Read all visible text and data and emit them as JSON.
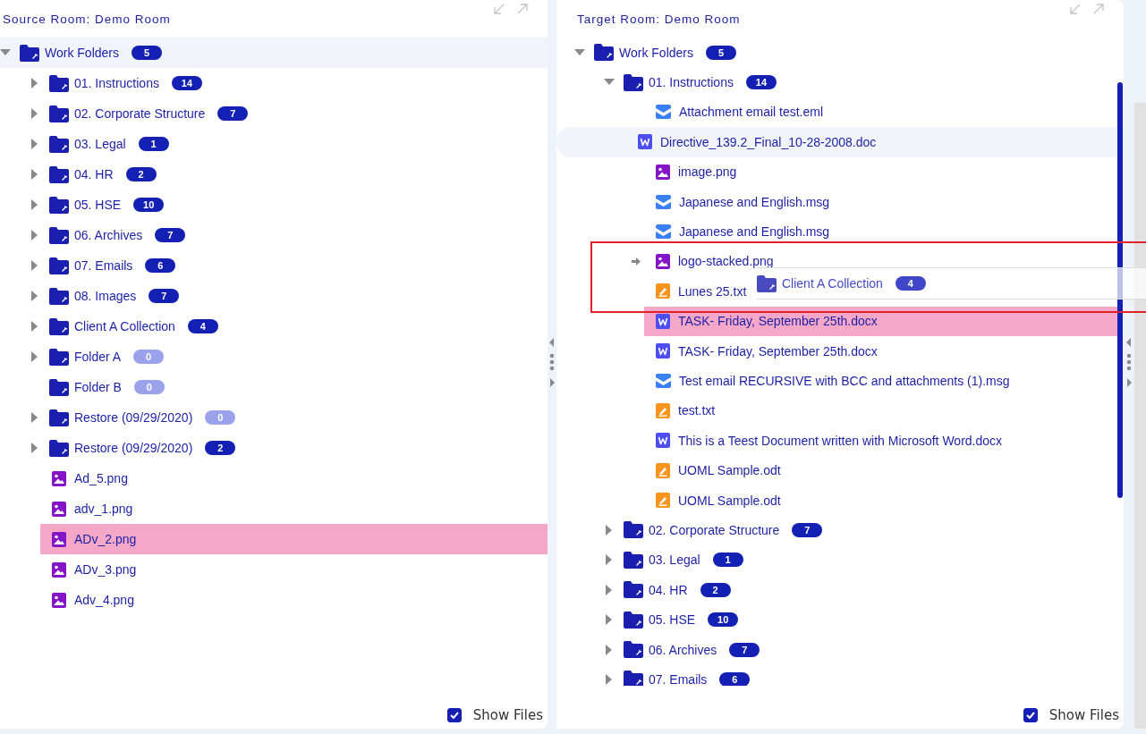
{
  "panels": [
    {
      "title": "Source Room: Demo Room",
      "show_files": {
        "label": "Show Files",
        "checked": true
      },
      "tree": [
        {
          "kind": "folder",
          "label": "Work Folders",
          "count": "5",
          "dimmed": false,
          "expanded": true,
          "selected": false,
          "hovered": true,
          "children": [
            {
              "kind": "folder",
              "label": "01. Instructions",
              "count": "14",
              "dimmed": false,
              "expanded": false,
              "selected": false
            },
            {
              "kind": "folder",
              "label": "02. Corporate Structure",
              "count": "7",
              "dimmed": false,
              "expanded": false,
              "selected": false
            },
            {
              "kind": "folder",
              "label": "03. Legal",
              "count": "1",
              "dimmed": false,
              "expanded": false,
              "selected": false
            },
            {
              "kind": "folder",
              "label": "04. HR",
              "count": "2",
              "dimmed": false,
              "expanded": false,
              "selected": false
            },
            {
              "kind": "folder",
              "label": "05. HSE",
              "count": "10",
              "dimmed": false,
              "expanded": false,
              "selected": false
            },
            {
              "kind": "folder",
              "label": "06. Archives",
              "count": "7",
              "dimmed": false,
              "expanded": false,
              "selected": false
            },
            {
              "kind": "folder",
              "label": "07. Emails",
              "count": "6",
              "dimmed": false,
              "expanded": false,
              "selected": false
            },
            {
              "kind": "folder",
              "label": "08. Images",
              "count": "7",
              "dimmed": false,
              "expanded": false,
              "selected": false
            },
            {
              "kind": "folder",
              "label": "Client A Collection",
              "count": "4",
              "dimmed": false,
              "expanded": false,
              "selected": false
            },
            {
              "kind": "folder",
              "label": "Folder A",
              "count": "0",
              "dimmed": true,
              "expanded": false,
              "selected": false
            },
            {
              "kind": "folder",
              "label": "Folder B",
              "count": "0",
              "dimmed": true,
              "selected": false
            },
            {
              "kind": "folder",
              "label": "Restore (09/29/2020)",
              "count": "0",
              "dimmed": true,
              "expanded": false,
              "selected": false
            },
            {
              "kind": "folder",
              "label": "Restore (09/29/2020)",
              "count": "2",
              "dimmed": false,
              "expanded": false,
              "selected": false
            },
            {
              "kind": "image",
              "label": "Ad_5.png",
              "selected": false
            },
            {
              "kind": "image",
              "label": "adv_1.png",
              "selected": false
            },
            {
              "kind": "image",
              "label": "ADv_2.png",
              "selected": true
            },
            {
              "kind": "image",
              "label": "ADv_3.png",
              "selected": false
            },
            {
              "kind": "image",
              "label": "Adv_4.png",
              "selected": false
            }
          ]
        }
      ]
    },
    {
      "title": "Target Room: Demo Room",
      "show_files": {
        "label": "Show Files",
        "checked": true
      },
      "drag_preview": {
        "label": "Client A Collection",
        "count": "4"
      },
      "tree": [
        {
          "kind": "folder",
          "label": "Work Folders",
          "count": "5",
          "dimmed": false,
          "expanded": true,
          "selected": false,
          "children": [
            {
              "kind": "folder",
              "label": "01. Instructions",
              "count": "14",
              "dimmed": false,
              "expanded": true,
              "selected": false,
              "children": [
                {
                  "kind": "email",
                  "label": "Attachment email test.eml",
                  "selected": false
                },
                {
                  "kind": "word",
                  "label": "Directive_139.2_Final_10-28-2008.doc",
                  "selected": false,
                  "hovered": true
                },
                {
                  "kind": "image",
                  "label": "image.png",
                  "selected": false
                },
                {
                  "kind": "email",
                  "label": "Japanese and English.msg",
                  "selected": false
                },
                {
                  "kind": "email",
                  "label": "Japanese and English.msg",
                  "selected": false
                },
                {
                  "kind": "image",
                  "label": "logo-stacked.png",
                  "selected": false,
                  "drop_target": true
                },
                {
                  "kind": "text",
                  "label": "Lunes 25.txt",
                  "selected": false
                },
                {
                  "kind": "word",
                  "label": "TASK- Friday, September 25th.docx",
                  "selected": true
                },
                {
                  "kind": "word",
                  "label": "TASK- Friday, September 25th.docx",
                  "selected": false
                },
                {
                  "kind": "email",
                  "label": "Test email RECURSIVE with BCC and attachments (1).msg",
                  "selected": false
                },
                {
                  "kind": "text",
                  "label": "test.txt",
                  "selected": false
                },
                {
                  "kind": "word",
                  "label": "This is a Teest Document written with Microsoft Word.docx",
                  "selected": false
                },
                {
                  "kind": "text",
                  "label": "UOML Sample.odt",
                  "selected": false
                },
                {
                  "kind": "text",
                  "label": "UOML Sample.odt",
                  "selected": false
                }
              ]
            },
            {
              "kind": "folder",
              "label": "02. Corporate Structure",
              "count": "7",
              "dimmed": false,
              "expanded": false,
              "selected": false
            },
            {
              "kind": "folder",
              "label": "03. Legal",
              "count": "1",
              "dimmed": false,
              "expanded": false,
              "selected": false
            },
            {
              "kind": "folder",
              "label": "04. HR",
              "count": "2",
              "dimmed": false,
              "expanded": false,
              "selected": false
            },
            {
              "kind": "folder",
              "label": "05. HSE",
              "count": "10",
              "dimmed": false,
              "expanded": false,
              "selected": false
            },
            {
              "kind": "folder",
              "label": "06. Archives",
              "count": "7",
              "dimmed": false,
              "expanded": false,
              "selected": false
            },
            {
              "kind": "folder",
              "label": "07. Emails",
              "count": "6",
              "dimmed": false,
              "expanded": false,
              "selected": false
            }
          ]
        }
      ]
    }
  ]
}
